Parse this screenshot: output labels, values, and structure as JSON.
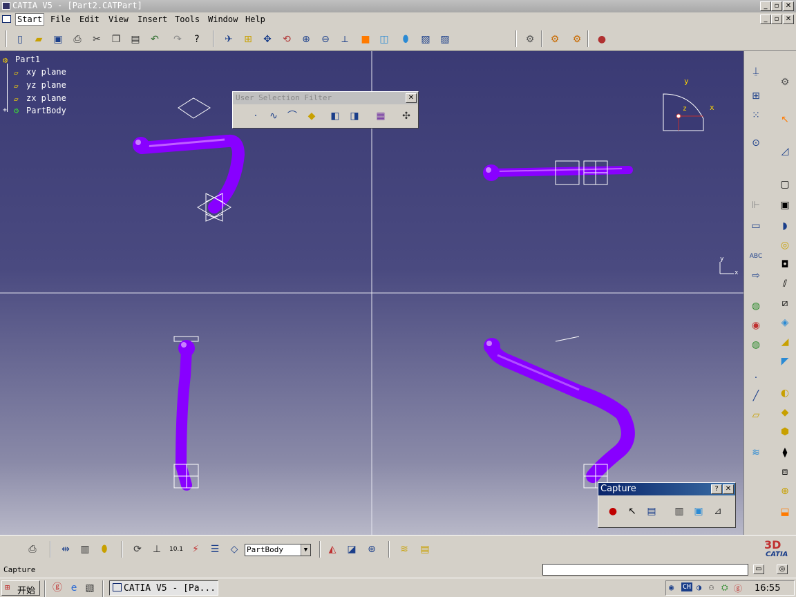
{
  "window": {
    "title": "CATIA V5 - [Part2.CATPart]",
    "min_glyph": "_",
    "max_glyph": "▫",
    "close_glyph": "✕"
  },
  "menu": {
    "items": [
      "Start",
      "File",
      "Edit",
      "View",
      "Insert",
      "Tools",
      "Window",
      "Help"
    ]
  },
  "toolbar": {
    "icons": [
      "new-icon",
      "open-icon",
      "save-icon",
      "print-icon",
      "cut-icon",
      "copy-icon",
      "paste-icon",
      "undo-icon",
      "redo-icon",
      "whats-this-icon",
      "fly-mode-icon",
      "fit-all-icon",
      "pan-icon",
      "rotate-icon",
      "zoom-in-icon",
      "zoom-out-icon",
      "normal-view-icon",
      "multi-view-icon",
      "iso-view-icon",
      "shading-icon",
      "hide-show-icon",
      "swap-space-icon",
      "catalog-icon",
      "assembly-icon",
      "constraint-icon",
      "material-icon"
    ]
  },
  "tree": {
    "root": "Part1",
    "items": [
      "xy plane",
      "yz plane",
      "zx plane",
      "PartBody"
    ]
  },
  "selection_filter": {
    "title": "User Selection Filter",
    "close_glyph": "✕"
  },
  "capture": {
    "title": "Capture",
    "help_glyph": "?",
    "close_glyph": "✕"
  },
  "compass": {
    "axis_y": "y",
    "axis_x": "x",
    "axis_z": "z"
  },
  "mini_axis": {
    "y": "y",
    "x": "x"
  },
  "bottom_toolbar": {
    "current_body": "PartBody"
  },
  "brand": {
    "logo_text": "CATIA"
  },
  "status": {
    "message": "Capture"
  },
  "taskbar": {
    "start_label": "开始",
    "task_label": "CATIA V5 - [Pa...",
    "tray_lang": "CH",
    "clock": "16:55"
  },
  "colors": {
    "part_purple": "#8800ff",
    "viewport_top": "#3a3a74",
    "title_blue": "#0a246a"
  }
}
